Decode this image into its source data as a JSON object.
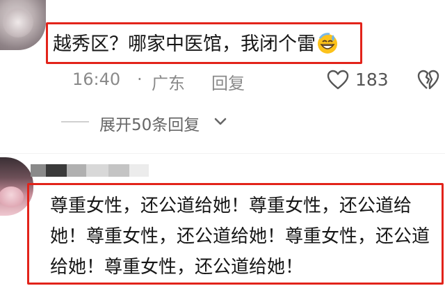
{
  "comments": [
    {
      "text": "越秀区？哪家中医馆，我闭个雷",
      "emoji": "grinning-sweat-emoji",
      "time": "16:40",
      "location": "广东",
      "reply_label": "回复",
      "likes": "183",
      "expand_label": "展开50条回复"
    },
    {
      "text": "尊重女性，还公道给她！尊重女性，还公道给她！尊重女性，还公道给她！尊重女性，还公道给她！尊重女性，还公道给她！"
    }
  ],
  "colors": {
    "highlight_border": "#e2231a",
    "meta_text": "#8a8a8a"
  },
  "icons": [
    "heart-outline-icon",
    "broken-heart-icon",
    "chevron-down-icon"
  ]
}
